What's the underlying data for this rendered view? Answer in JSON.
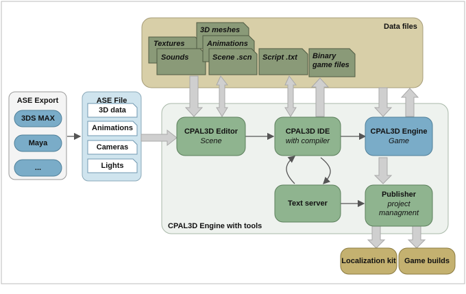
{
  "data_files": {
    "title": "Data files",
    "items": {
      "textures": "Textures",
      "sounds": "Sounds",
      "meshes": "3D meshes",
      "animations": "Animations",
      "scene": "Scene .scn",
      "script": "Script .txt",
      "binary_line1": "Binary",
      "binary_line2": "game files"
    }
  },
  "ase_export": {
    "title": "ASE Export",
    "items": [
      "3DS MAX",
      "Maya",
      "..."
    ]
  },
  "ase_file": {
    "title": "ASE File",
    "items": [
      "3D data",
      "Animations",
      "Cameras",
      "Lights"
    ]
  },
  "engine": {
    "title": "CPAL3D Engine with tools",
    "editor": {
      "title": "CPAL3D Editor",
      "subtitle": "Scene"
    },
    "ide": {
      "title": "CPAL3D IDE",
      "subtitle": "with compiler"
    },
    "engine_node": {
      "title": "CPAL3D Engine",
      "subtitle": "Game"
    },
    "text_server": {
      "title": "Text server"
    },
    "publisher": {
      "title": "Publisher",
      "subtitle_line1": "project",
      "subtitle_line2": "managment"
    }
  },
  "outputs": {
    "localization": "Localization kit",
    "game_builds": "Game builds"
  },
  "colors": {
    "green_node": "#8fb48f",
    "blue_node": "#7aacc8",
    "tan_panel": "#d8cfa8",
    "doc_fill": "#8a9a78",
    "output_fill": "#c4b170",
    "engine_panel": "#eef2ee",
    "ase_file_panel": "#cfe4ee",
    "arrow_gray": "#cfcfcf"
  }
}
